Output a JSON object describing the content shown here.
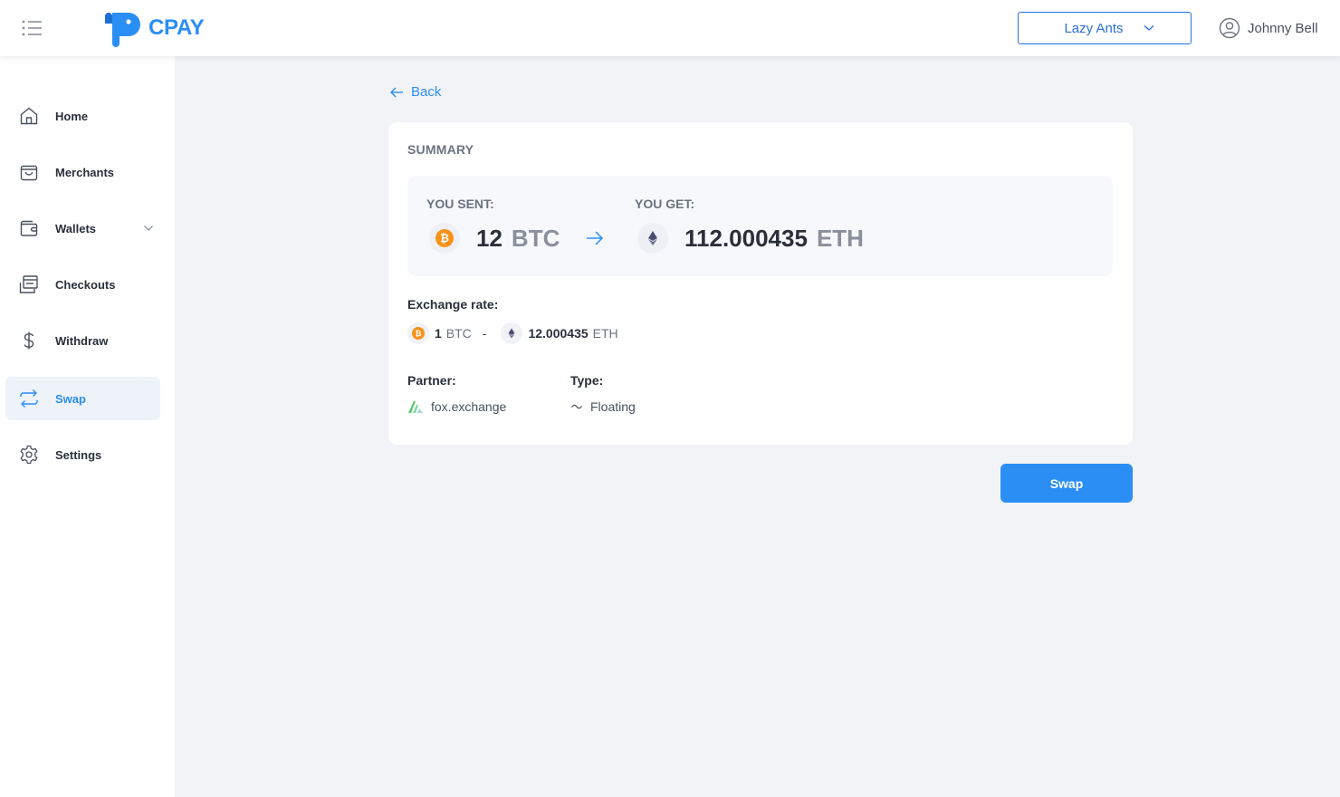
{
  "header": {
    "logo_text": "CPAY",
    "org_select": "Lazy Ants",
    "user_name": "Johnny Bell"
  },
  "sidebar": {
    "items": [
      {
        "label": "Home",
        "icon": "home-icon"
      },
      {
        "label": "Merchants",
        "icon": "bag-icon"
      },
      {
        "label": "Wallets",
        "icon": "wallet-icon",
        "has_submenu": true
      },
      {
        "label": "Checkouts",
        "icon": "checkout-icon"
      },
      {
        "label": "Withdraw",
        "icon": "dollar-icon"
      },
      {
        "label": "Swap",
        "icon": "swap-icon",
        "active": true
      },
      {
        "label": "Settings",
        "icon": "gear-icon"
      }
    ]
  },
  "main": {
    "back_label": "Back",
    "summary": {
      "title": "SUMMARY",
      "sent_label": "YOU SENT:",
      "sent_amount": "12",
      "sent_currency": "BTC",
      "get_label": "YOU GET:",
      "get_amount": "112.000435",
      "get_currency": "ETH"
    },
    "exchange_rate": {
      "label": "Exchange rate:",
      "from_amount": "1",
      "from_currency": "BTC",
      "separator": "-",
      "to_amount": "12.000435",
      "to_currency": "ETH"
    },
    "partner": {
      "label": "Partner:",
      "value": "fox.exchange"
    },
    "type": {
      "label": "Type:",
      "value": "Floating"
    },
    "swap_button": "Swap"
  },
  "colors": {
    "accent": "#2a8ef5",
    "btc": "#f7931a",
    "eth": "#4b4f73",
    "background": "#f2f3f7"
  }
}
